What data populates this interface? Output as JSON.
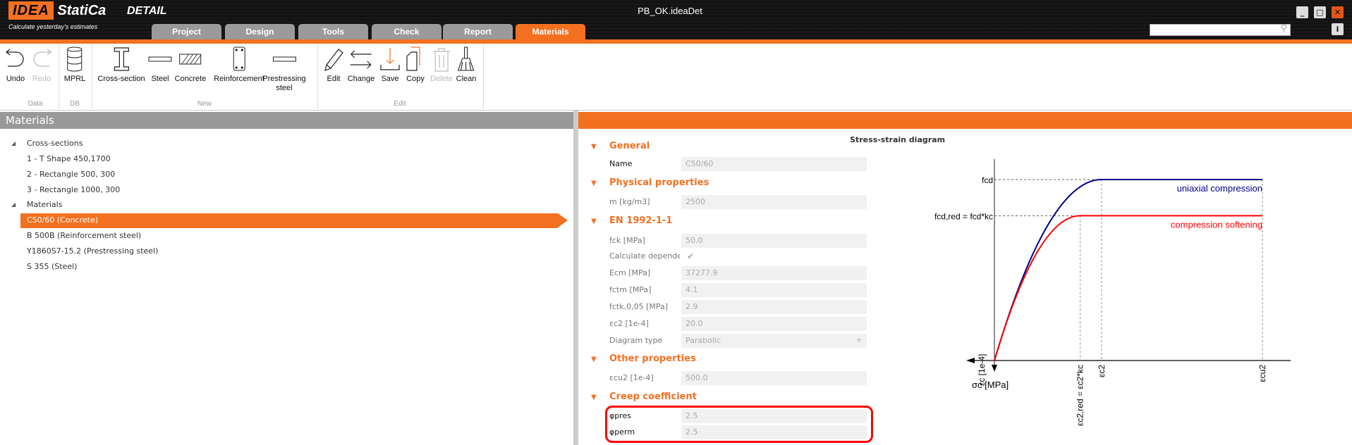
{
  "app": {
    "brand": "StatiCa",
    "brand_prefix": "IDEA",
    "product": "DETAIL",
    "slogan": "Calculate yesterday's estimates",
    "window_title": "PB_OK.ideaDet"
  },
  "tabs": [
    {
      "label": "Project"
    },
    {
      "label": "Design"
    },
    {
      "label": "Tools"
    },
    {
      "label": "Check"
    },
    {
      "label": "Report"
    },
    {
      "label": "Materials",
      "active": true
    }
  ],
  "search": {
    "placeholder": "",
    "value": ""
  },
  "window_buttons": {
    "minimize": "_",
    "maximize": "□",
    "close": "✕",
    "info": "i"
  },
  "ribbon": {
    "buttons": {
      "undo": "Undo",
      "redo": "Redo",
      "mprl": "MPRL",
      "cross_section": "Cross-section",
      "steel": "Steel",
      "concrete": "Concrete",
      "reinforcement": "Reinforcement",
      "prestressing": "Prestressing",
      "prestressing2": "steel",
      "edit": "Edit",
      "change": "Change",
      "save": "Save",
      "copy": "Copy",
      "delete": "Delete",
      "clean": "Clean"
    },
    "groups": {
      "data": "Data",
      "db": "DB",
      "new": "New",
      "edit": "Edit"
    }
  },
  "left_panel": {
    "title": "Materials",
    "tree": [
      {
        "label": "Cross-sections",
        "level": 0
      },
      {
        "label": "1 - T Shape 450,1700",
        "level": 1
      },
      {
        "label": "2 - Rectangle 500, 300",
        "level": 1
      },
      {
        "label": "3 - Rectangle 1000, 300",
        "level": 1
      },
      {
        "label": "Materials",
        "level": 0
      },
      {
        "label": "C50/60 (Concrete)",
        "level": 1,
        "selected": true
      },
      {
        "label": "B 500B (Reinforcement steel)",
        "level": 1
      },
      {
        "label": "Y1860S7-15.2 (Prestressing steel)",
        "level": 1
      },
      {
        "label": "S 355 (Steel)",
        "level": 1
      }
    ]
  },
  "properties": {
    "general": {
      "title": "General",
      "name_label": "Name",
      "name_value": "C50/60"
    },
    "physical": {
      "title": "Physical properties",
      "m_label": "m [kg/m3]",
      "m_value": "2500"
    },
    "en": {
      "title": "EN 1992-1-1",
      "fck_label": "fck [MPa]",
      "fck_value": "50.0",
      "calc_label": "Calculate depende",
      "calc_checked": true,
      "ecm_label": "Ecm [MPa]",
      "ecm_value": "37277.9",
      "fctm_label": "fctm [MPa]",
      "fctm_value": "4.1",
      "fctk_label": "fctk,0,05 [MPa]",
      "fctk_value": "2.9",
      "ec2_label": "εc2 [1e-4]",
      "ec2_value": "20.0",
      "diagram_label": "Diagram type",
      "diagram_value": "Parabolic"
    },
    "other": {
      "title": "Other properties",
      "ecu2_label": "εcu2 [1e-4]",
      "ecu2_value": "500.0"
    },
    "creep": {
      "title": "Creep coefficient",
      "pres_label": "φpres",
      "pres_value": "2.5",
      "perm_label": "φperm",
      "perm_value": "2.5"
    }
  },
  "chart_data": {
    "type": "line",
    "title": "Stress-strain diagram",
    "xlabel": "εc [1e-4]",
    "ylabel": "σc [MPa]",
    "y_ticks": [
      {
        "label": "fcd",
        "value": 1.0
      },
      {
        "label": "fcd,red = fcd*kc",
        "value": 0.8
      }
    ],
    "x_ticks": [
      {
        "label": "εc2,red = εc2*kc",
        "value": 0.8
      },
      {
        "label": "εc2",
        "value": 1.0
      },
      {
        "label": "εcu2",
        "value": 2.5
      }
    ],
    "xlim": [
      0,
      2.5
    ],
    "ylim": [
      0,
      1.0
    ],
    "series": [
      {
        "name": "uniaxial compression",
        "color": "#00008b",
        "peak_strain": 1.0,
        "peak_stress": 1.0,
        "ultimate_strain": 2.5
      },
      {
        "name": "compression softening",
        "color": "#ff0000",
        "peak_strain": 0.8,
        "peak_stress": 0.8,
        "ultimate_strain": 2.5
      }
    ]
  }
}
